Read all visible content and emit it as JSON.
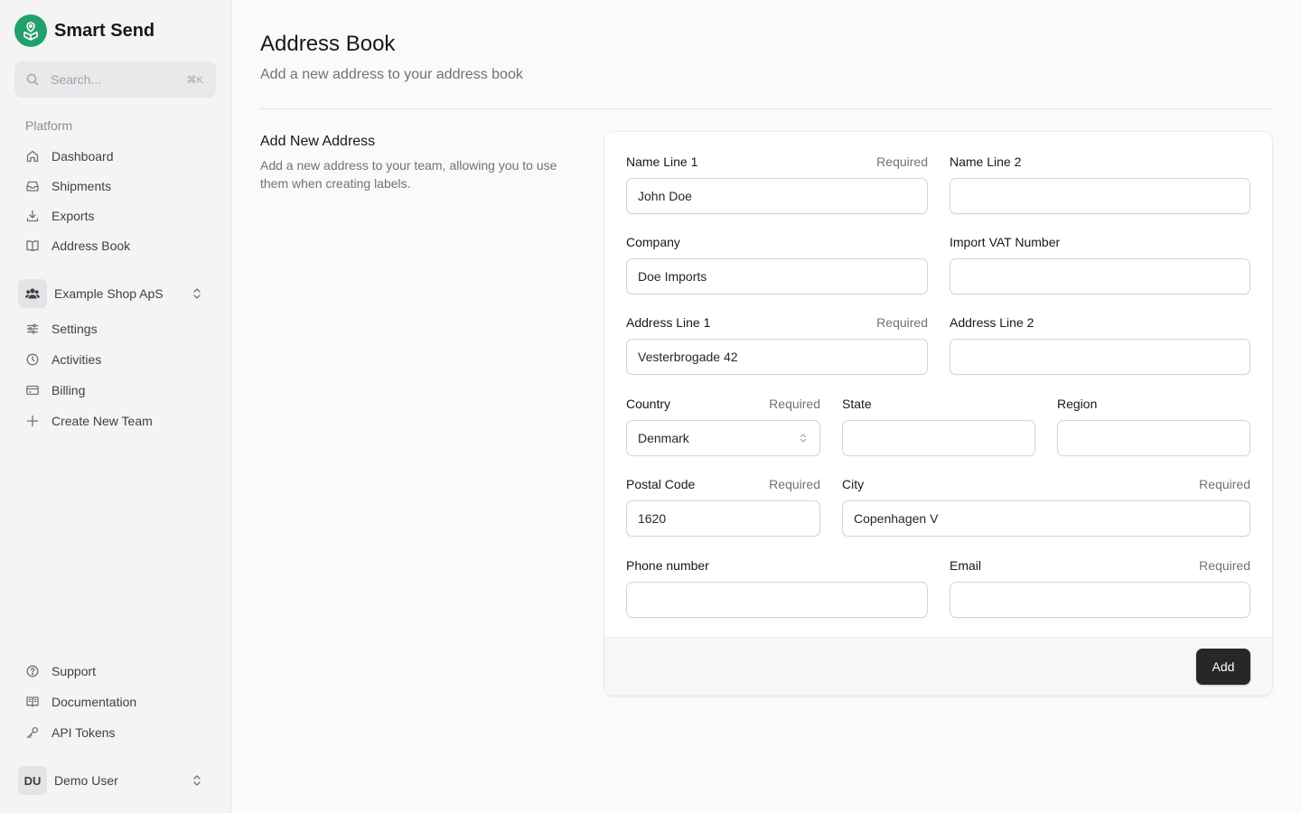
{
  "brand": {
    "name": "Smart Send",
    "logo_icon": "package-pin-icon",
    "color": "#22a06b"
  },
  "search": {
    "placeholder": "Search...",
    "shortcut": "⌘K"
  },
  "sidebar": {
    "platform_label": "Platform",
    "platform_items": [
      {
        "label": "Dashboard",
        "icon": "home-icon"
      },
      {
        "label": "Shipments",
        "icon": "inbox-icon"
      },
      {
        "label": "Exports",
        "icon": "download-icon"
      },
      {
        "label": "Address Book",
        "icon": "book-icon"
      }
    ],
    "team": {
      "name": "Example Shop ApS",
      "icon": "users-icon"
    },
    "team_items": [
      {
        "label": "Settings",
        "icon": "sliders-icon"
      },
      {
        "label": "Activities",
        "icon": "clock-icon"
      },
      {
        "label": "Billing",
        "icon": "credit-card-icon"
      },
      {
        "label": "Create New Team",
        "icon": "plus-icon"
      }
    ],
    "footer_items": [
      {
        "label": "Support",
        "icon": "help-circle-icon"
      },
      {
        "label": "Documentation",
        "icon": "book-open-icon"
      },
      {
        "label": "API Tokens",
        "icon": "key-icon"
      }
    ],
    "user": {
      "initials": "DU",
      "name": "Demo User"
    }
  },
  "page": {
    "title": "Address Book",
    "subtitle": "Add a new address to your address book"
  },
  "section": {
    "title": "Add New Address",
    "description": "Add a new address to your team, allowing you to use them when creating labels."
  },
  "form": {
    "required_label": "Required",
    "fields": {
      "name_line_1": {
        "label": "Name Line 1",
        "value": "John Doe",
        "required": true
      },
      "name_line_2": {
        "label": "Name Line 2",
        "value": "",
        "required": false
      },
      "company": {
        "label": "Company",
        "value": "Doe Imports",
        "required": false
      },
      "import_vat": {
        "label": "Import VAT Number",
        "value": "",
        "required": false
      },
      "address_line_1": {
        "label": "Address Line 1",
        "value": "Vesterbrogade 42",
        "required": true
      },
      "address_line_2": {
        "label": "Address Line 2",
        "value": "",
        "required": false
      },
      "country": {
        "label": "Country",
        "value": "Denmark",
        "required": true
      },
      "state": {
        "label": "State",
        "value": "",
        "required": false
      },
      "region": {
        "label": "Region",
        "value": "",
        "required": false
      },
      "postal_code": {
        "label": "Postal Code",
        "value": "1620",
        "required": true
      },
      "city": {
        "label": "City",
        "value": "Copenhagen V",
        "required": true
      },
      "phone": {
        "label": "Phone number",
        "value": "",
        "required": false
      },
      "email": {
        "label": "Email",
        "value": "",
        "required": true
      }
    },
    "submit_label": "Add"
  }
}
